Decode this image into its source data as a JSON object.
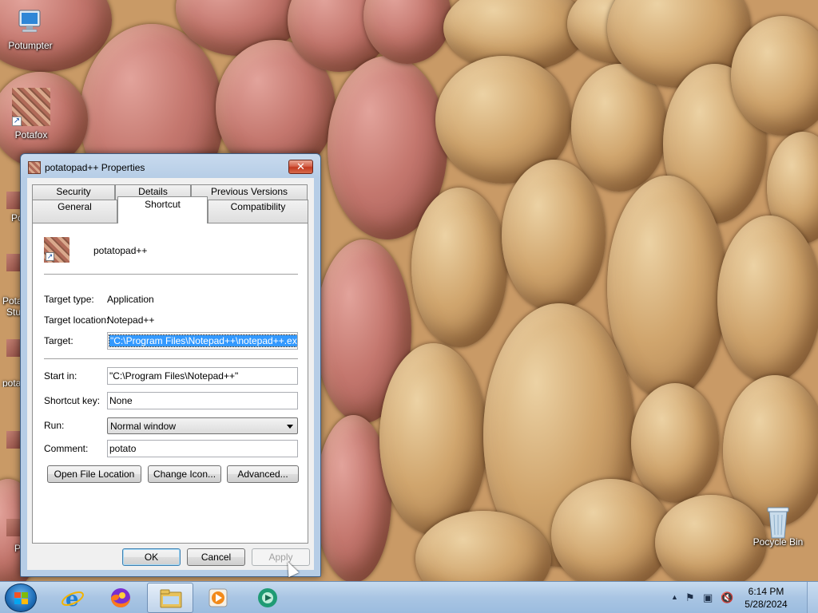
{
  "desktop": {
    "icons": [
      {
        "label": "Potumpter"
      },
      {
        "label": "Potafox"
      },
      {
        "label": "Pocycle Bin"
      }
    ],
    "partial_icons": [
      {
        "label": "Po"
      },
      {
        "label": "Pota"
      },
      {
        "label": "Stu"
      },
      {
        "label": "pota"
      },
      {
        "label": "P"
      }
    ]
  },
  "dialog": {
    "title": "potatopad++ Properties",
    "close_glyph": "✕",
    "tabs_row1": [
      "Security",
      "Details",
      "Previous Versions"
    ],
    "tabs_row2": [
      "General",
      "Shortcut",
      "Compatibility"
    ],
    "active_tab": "Shortcut",
    "shortcut_name": "potatopad++",
    "target_type_label": "Target type:",
    "target_type_value": "Application",
    "target_location_label": "Target location:",
    "target_location_value": "Notepad++",
    "target_label": "Target:",
    "target_value": "\"C:\\Program Files\\Notepad++\\notepad++.exe\"",
    "start_in_label": "Start in:",
    "start_in_value": "\"C:\\Program Files\\Notepad++\"",
    "shortcut_key_label": "Shortcut key:",
    "shortcut_key_value": "None",
    "run_label": "Run:",
    "run_value": "Normal window",
    "comment_label": "Comment:",
    "comment_value": "potato",
    "open_file_location": "Open File Location",
    "change_icon": "Change Icon...",
    "advanced": "Advanced...",
    "ok": "OK",
    "cancel": "Cancel",
    "apply": "Apply"
  },
  "taskbar": {
    "time": "6:14 PM",
    "date": "5/28/2024",
    "tray_chevron": "▲",
    "tray_flag": "⚑",
    "tray_network": "▣",
    "tray_volume": "🔇"
  },
  "colors": {
    "accent": "#3399ff",
    "close_red": "#c23a1f",
    "taskbar": "#a9c5e3"
  }
}
